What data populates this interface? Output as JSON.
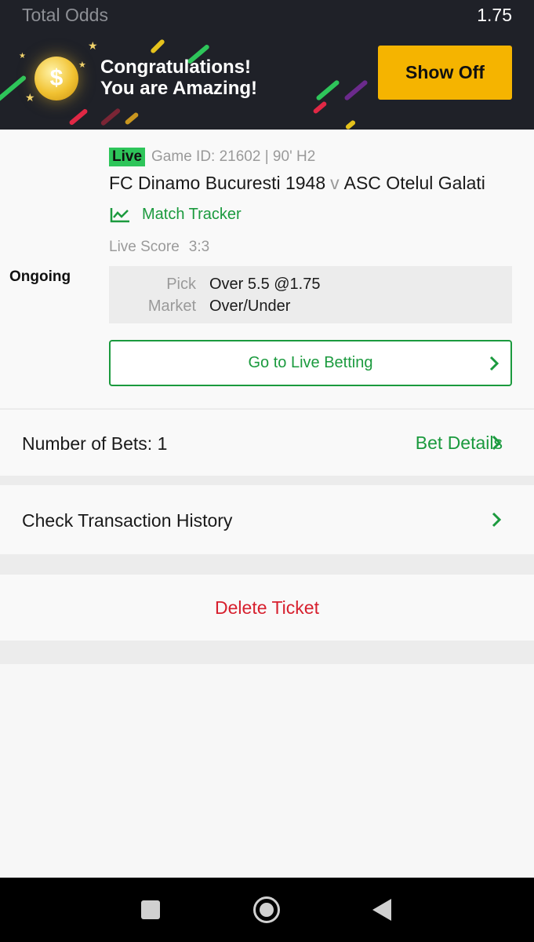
{
  "header": {
    "total_odds_label": "Total Odds",
    "total_odds_value": "1.75",
    "congrats_line1": "Congratulations!",
    "congrats_line2": "You are Amazing!",
    "show_off_label": "Show Off"
  },
  "ticket": {
    "status": "Ongoing",
    "live_badge": "Live",
    "game_meta": "Game ID: 21602 | 90' H2",
    "home_team": "FC Dinamo Bucuresti 1948",
    "versus": "v",
    "away_team": "ASC Otelul Galati",
    "match_tracker_label": "Match Tracker",
    "live_score_label": "Live Score",
    "live_score_value": "3:3",
    "pick_label": "Pick",
    "pick_value": "Over 5.5 @1.75",
    "market_label": "Market",
    "market_value": "Over/Under",
    "live_betting_button": "Go to Live Betting"
  },
  "summary": {
    "number_of_bets": "Number of Bets: 1",
    "bet_details_link": "Bet Details",
    "transaction_history": "Check Transaction History",
    "delete_ticket": "Delete Ticket"
  },
  "colors": {
    "header_bg": "#1f2128",
    "accent_green": "#1b9a3e",
    "live_badge": "#2ec55a",
    "show_off_button": "#f5b400",
    "delete_red": "#d7202e"
  },
  "navbar": {
    "icons": [
      "recents-square-icon",
      "home-circle-icon",
      "back-triangle-icon"
    ]
  }
}
